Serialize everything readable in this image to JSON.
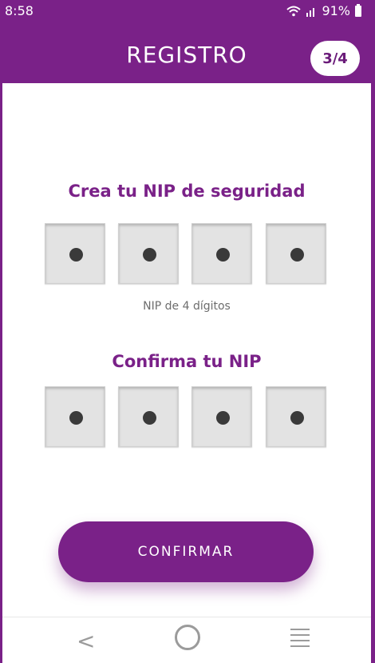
{
  "status_bar": {
    "time": "8:58",
    "battery": "91%"
  },
  "header": {
    "title": "REGISTRO",
    "step": "3/4"
  },
  "create_pin": {
    "label": "Crea tu NIP de seguridad",
    "hint": "NIP de 4 dígitos",
    "digits_filled": 4
  },
  "confirm_pin": {
    "label": "Confirma tu NIP",
    "digits_filled": 4
  },
  "actions": {
    "confirm_label": "CONFIRMAR"
  },
  "colors": {
    "brand": "#7a2188",
    "pin_box": "#e3e3e3",
    "dot": "#3a3a3a"
  },
  "nav": {
    "icons": [
      "back-icon",
      "home-icon",
      "menu-icon"
    ]
  }
}
